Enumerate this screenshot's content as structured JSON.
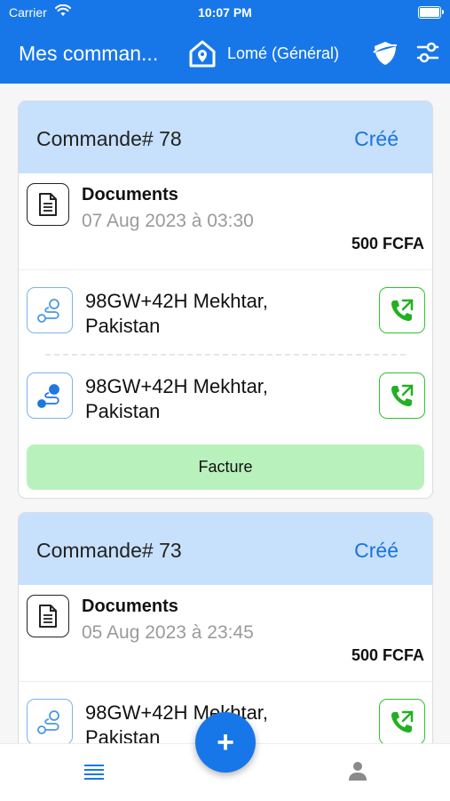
{
  "status_bar": {
    "carrier": "Carrier",
    "time": "10:07 PM"
  },
  "app_bar": {
    "title": "Mes comman...",
    "location": "Lomé (Général)"
  },
  "orders": [
    {
      "number": "Commande# 78",
      "status": "Créé",
      "doc_title": "Documents",
      "doc_date": "07 Aug 2023 à 03:30",
      "price": "500 FCFA",
      "pickup": "98GW+42H Mekhtar, Pakistan",
      "dropoff": "98GW+42H Mekhtar, Pakistan",
      "invoice_label": "Facture"
    },
    {
      "number": "Commande# 73",
      "status": "Créé",
      "doc_title": "Documents",
      "doc_date": "05 Aug 2023 à 23:45",
      "price": "500 FCFA",
      "pickup": "98GW+42H Mekhtar, Pakistan"
    }
  ],
  "fab_label": "+",
  "colors": {
    "primary": "#1877e8",
    "card_header": "#c7e0fb",
    "status_text": "#1a73e0",
    "call_green": "#2ec22e",
    "invoice_bg": "#b9f1bc"
  },
  "icons": {
    "status": [
      "wifi-icon",
      "battery-icon"
    ],
    "app_bar": [
      "location-home-icon",
      "shield-icon",
      "filter-sliders-icon"
    ],
    "card": [
      "document-icon",
      "route-pickup-icon",
      "route-dropoff-icon",
      "phone-call-icon"
    ],
    "bottom_nav": [
      "list-icon",
      "user-icon"
    ]
  }
}
